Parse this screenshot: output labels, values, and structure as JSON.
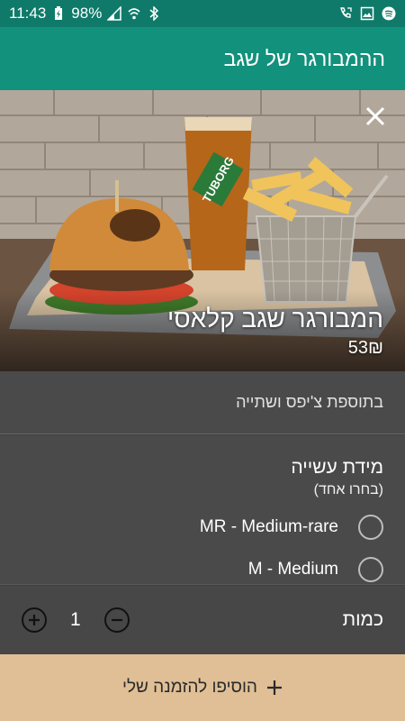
{
  "status": {
    "time": "11:43",
    "battery": "98%",
    "icons": [
      "battery-charging-icon",
      "signal-icon",
      "wifi-icon",
      "bluetooth-icon",
      "call-icon",
      "image-icon",
      "spotify-icon"
    ]
  },
  "app": {
    "title": "ההמבורגר של שגב"
  },
  "item": {
    "name": "המבורגר שגב קלאסי",
    "price": "53₪",
    "description": "בתוספת צ'יפס ושתייה",
    "image_text": "TUBORG"
  },
  "doneness": {
    "title": "מידת עשייה",
    "subtitle": "(בחרו אחד)",
    "options": [
      {
        "label": "MR - Medium-rare"
      },
      {
        "label": "M - Medium"
      }
    ]
  },
  "quantity": {
    "label": "כמות",
    "value": "1"
  },
  "add_button": {
    "label": "הוסיפו להזמנה שלי",
    "icon": "plus-icon"
  },
  "colors": {
    "status_bar": "#0f7a6a",
    "app_bar": "#12917c",
    "panel": "#4a4a4a",
    "add_button": "#e0bf96"
  }
}
